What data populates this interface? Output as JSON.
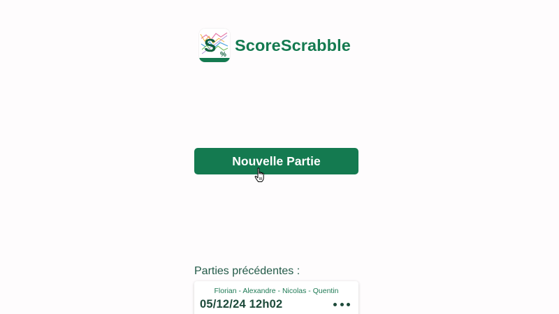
{
  "header": {
    "app_name": "ScoreScrabble",
    "logo_letter": "S",
    "logo_sub": "%"
  },
  "actions": {
    "new_game_label": "Nouvelle Partie"
  },
  "previous_games": {
    "section_label": "Parties précédentes :",
    "items": [
      {
        "players": "Florian - Alexandre - Nicolas - Quentin",
        "date": "05/12/24 12h02",
        "menu_icon": "more-horizontal-icon"
      }
    ]
  },
  "colors": {
    "brand_green": "#147a50",
    "background": "#fefcfd",
    "text_dark_green": "#1d4a3a"
  }
}
